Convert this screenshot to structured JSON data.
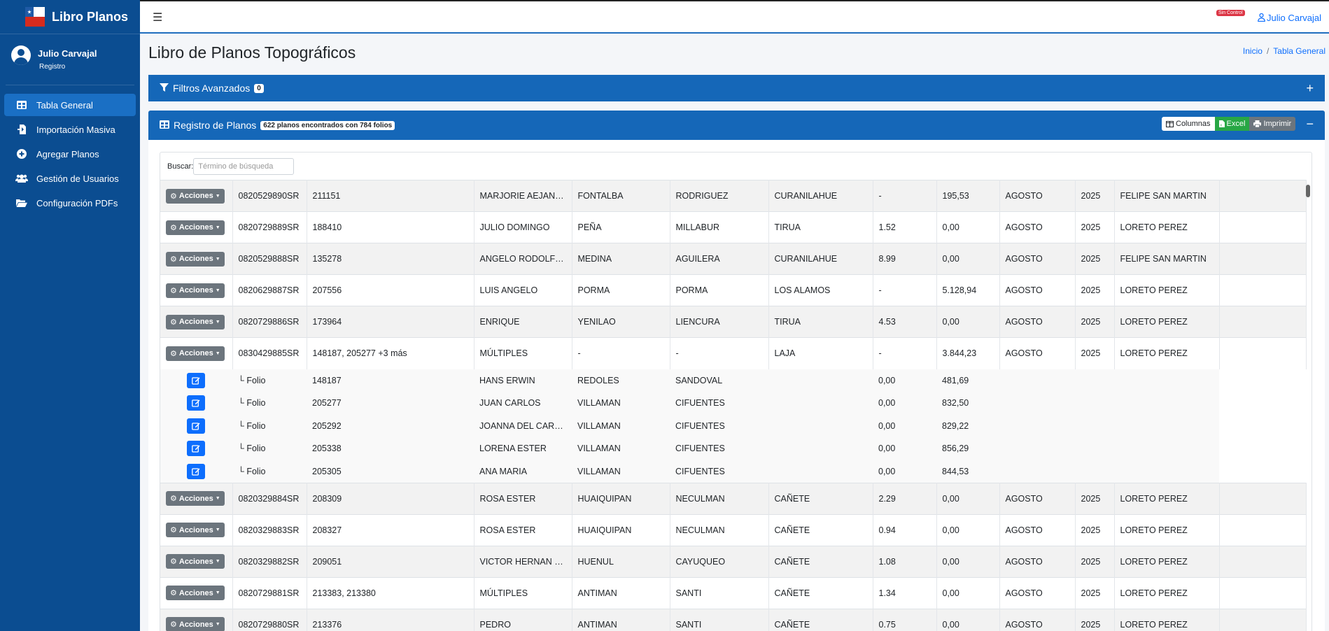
{
  "sidebar": {
    "brand": "Libro Planos",
    "user_name": "Julio Carvajal",
    "user_role": "Registro",
    "items": [
      {
        "label": "Tabla General",
        "icon": "table-icon"
      },
      {
        "label": "Importación Masiva",
        "icon": "file-import-icon"
      },
      {
        "label": "Agregar Planos",
        "icon": "plus-circle-icon"
      },
      {
        "label": "Gestión de Usuarios",
        "icon": "users-icon"
      },
      {
        "label": "Configuración PDFs",
        "icon": "folder-open-icon"
      }
    ]
  },
  "topbar": {
    "badge": "Sin Control",
    "user": "Julio Carvajal"
  },
  "page": {
    "title": "Libro de Planos Topográficos",
    "breadcrumb_home": "Inicio",
    "breadcrumb_sep": "/",
    "breadcrumb_current": "Tabla General"
  },
  "filtros": {
    "title": "Filtros Avanzados",
    "count": "0",
    "toggle": "+"
  },
  "registro": {
    "title": "Registro de Planos",
    "summary": "622 planos encontrados con 784 folios",
    "btn_columnas": "Columnas",
    "btn_excel": "Excel",
    "btn_imprimir": "Imprimir",
    "toggle": "−"
  },
  "search": {
    "label": "Buscar:",
    "placeholder": "Término de búsqueda"
  },
  "table": {
    "action_label": "Acciones",
    "folio_label": "└ Folio",
    "rows": [
      {
        "plano": "0820529890SR",
        "folios": "211151",
        "nombres": "MARJORIE AEJAND...",
        "ap1": "FONTALBA",
        "ap2": "RODRIGUEZ",
        "comuna": "CURANILAHUE",
        "ha": "-",
        "m2": "195,53",
        "mes": "AGOSTO",
        "anio": "2025",
        "resp": "FELIPE SAN MARTIN"
      },
      {
        "plano": "0820729889SR",
        "folios": "188410",
        "nombres": "JULIO DOMINGO",
        "ap1": "PEÑA",
        "ap2": "MILLABUR",
        "comuna": "TIRUA",
        "ha": "1.52",
        "m2": "0,00",
        "mes": "AGOSTO",
        "anio": "2025",
        "resp": "LORETO PEREZ"
      },
      {
        "plano": "0820529888SR",
        "folios": "135278",
        "nombres": "ANGELO RODOLFO...",
        "ap1": "MEDINA",
        "ap2": "AGUILERA",
        "comuna": "CURANILAHUE",
        "ha": "8.99",
        "m2": "0,00",
        "mes": "AGOSTO",
        "anio": "2025",
        "resp": "FELIPE SAN MARTIN"
      },
      {
        "plano": "0820629887SR",
        "folios": "207556",
        "nombres": "LUIS ANGELO",
        "ap1": "PORMA",
        "ap2": "PORMA",
        "comuna": "LOS ALAMOS",
        "ha": "-",
        "m2": "5.128,94",
        "mes": "AGOSTO",
        "anio": "2025",
        "resp": "LORETO PEREZ"
      },
      {
        "plano": "0820729886SR",
        "folios": "173964",
        "nombres": "ENRIQUE",
        "ap1": "YENILAO",
        "ap2": "LIENCURA",
        "comuna": "TIRUA",
        "ha": "4.53",
        "m2": "0,00",
        "mes": "AGOSTO",
        "anio": "2025",
        "resp": "LORETO PEREZ"
      },
      {
        "plano": "0830429885SR",
        "folios": "148187, 205277 +3 más",
        "nombres": "MÚLTIPLES",
        "ap1": "-",
        "ap2": "-",
        "comuna": "LAJA",
        "ha": "-",
        "m2": "3.844,23",
        "mes": "AGOSTO",
        "anio": "2025",
        "resp": "LORETO PEREZ",
        "sub": [
          {
            "folio": "148187",
            "nombres": "HANS ERWIN",
            "ap1": "REDOLES",
            "ap2": "SANDOVAL",
            "ha": "0,00",
            "m2": "481,69"
          },
          {
            "folio": "205277",
            "nombres": "JUAN CARLOS",
            "ap1": "VILLAMAN",
            "ap2": "CIFUENTES",
            "ha": "0,00",
            "m2": "832,50"
          },
          {
            "folio": "205292",
            "nombres": "JOANNA DEL CARMEN",
            "ap1": "VILLAMAN",
            "ap2": "CIFUENTES",
            "ha": "0,00",
            "m2": "829,22"
          },
          {
            "folio": "205338",
            "nombres": "LORENA ESTER",
            "ap1": "VILLAMAN",
            "ap2": "CIFUENTES",
            "ha": "0,00",
            "m2": "856,29"
          },
          {
            "folio": "205305",
            "nombres": "ANA MARIA",
            "ap1": "VILLAMAN",
            "ap2": "CIFUENTES",
            "ha": "0,00",
            "m2": "844,53"
          }
        ]
      },
      {
        "plano": "0820329884SR",
        "folios": "208309",
        "nombres": "ROSA ESTER",
        "ap1": "HUAIQUIPAN",
        "ap2": "NECULMAN",
        "comuna": "CAÑETE",
        "ha": "2.29",
        "m2": "0,00",
        "mes": "AGOSTO",
        "anio": "2025",
        "resp": "LORETO PEREZ"
      },
      {
        "plano": "0820329883SR",
        "folios": "208327",
        "nombres": "ROSA ESTER",
        "ap1": "HUAIQUIPAN",
        "ap2": "NECULMAN",
        "comuna": "CAÑETE",
        "ha": "0.94",
        "m2": "0,00",
        "mes": "AGOSTO",
        "anio": "2025",
        "resp": "LORETO PEREZ"
      },
      {
        "plano": "0820329882SR",
        "folios": "209051",
        "nombres": "VICTOR HERNAN ( ...",
        "ap1": "HUENUL",
        "ap2": "CAYUQUEO",
        "comuna": "CAÑETE",
        "ha": "1.08",
        "m2": "0,00",
        "mes": "AGOSTO",
        "anio": "2025",
        "resp": "LORETO PEREZ"
      },
      {
        "plano": "0820729881SR",
        "folios": "213383, 213380",
        "nombres": "MÚLTIPLES",
        "ap1": "ANTIMAN",
        "ap2": "SANTI",
        "comuna": "CAÑETE",
        "ha": "1.34",
        "m2": "0,00",
        "mes": "AGOSTO",
        "anio": "2025",
        "resp": "LORETO PEREZ"
      },
      {
        "plano": "0820729880SR",
        "folios": "213376",
        "nombres": "PEDRO",
        "ap1": "ANTIMAN",
        "ap2": "SANTI",
        "comuna": "CAÑETE",
        "ha": "0.75",
        "m2": "0,00",
        "mes": "AGOSTO",
        "anio": "2025",
        "resp": "LORETO PEREZ"
      }
    ]
  }
}
